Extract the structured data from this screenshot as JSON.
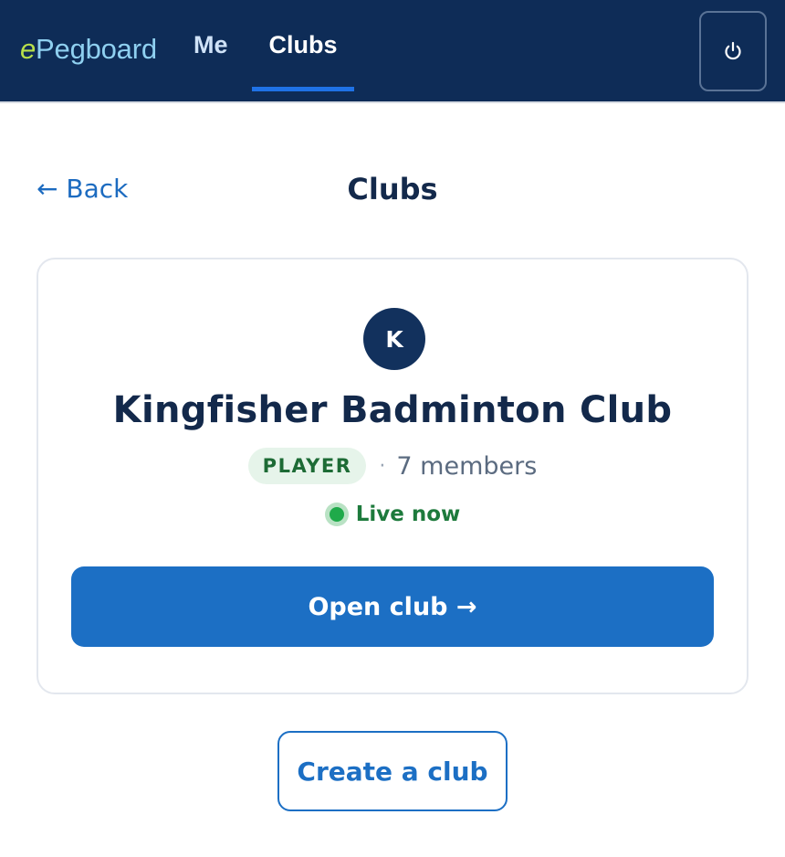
{
  "header": {
    "logo_e": "e",
    "logo_rest": "Pegboard",
    "tabs": [
      {
        "label": "Me",
        "active": false
      },
      {
        "label": "Clubs",
        "active": true
      }
    ],
    "power_icon": "power-icon"
  },
  "page": {
    "back_label": "← Back",
    "title": "Clubs"
  },
  "club": {
    "initial": "K",
    "name": "Kingfisher Badminton Club",
    "role": "PLAYER",
    "separator": "·",
    "members": "7 members",
    "status": "Live now",
    "open_label": "Open club →"
  },
  "actions": {
    "create_label": "Create a club"
  },
  "colors": {
    "header_bg": "#0e2c57",
    "accent": "#1c6fc4",
    "live_green": "#1faa4a",
    "role_badge_bg": "#e6f4ea"
  }
}
